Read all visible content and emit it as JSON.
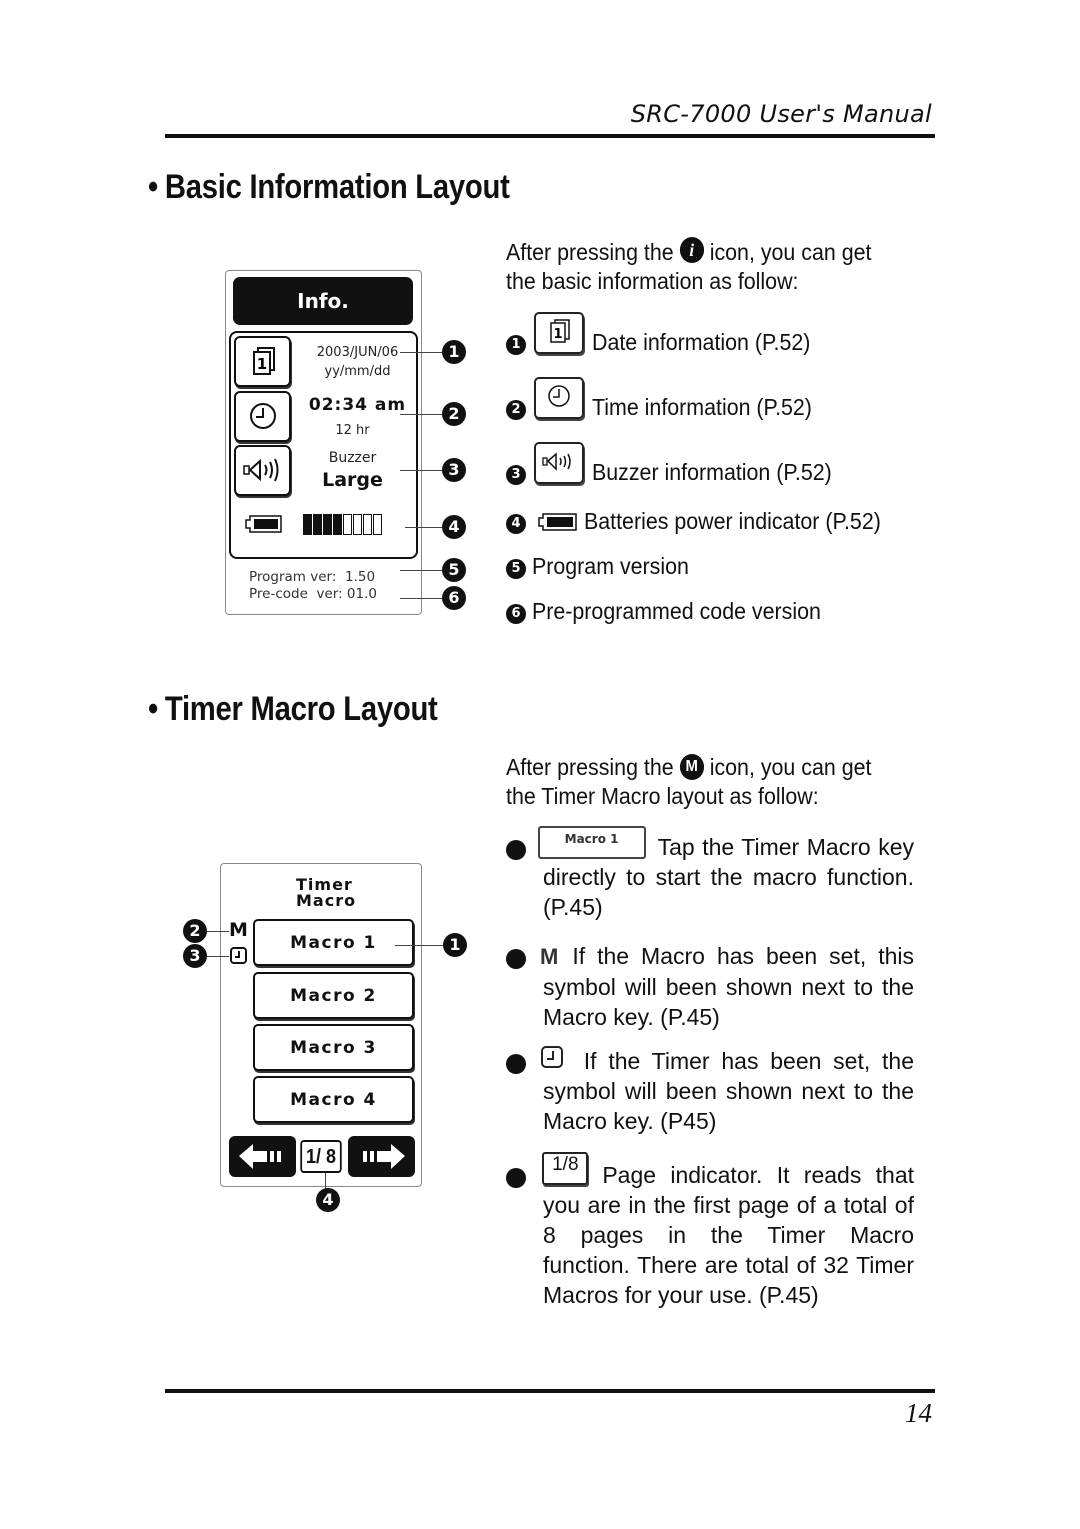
{
  "header": {
    "running_title": "SRC-7000 User's Manual"
  },
  "footer": {
    "page_number": "14"
  },
  "section_info": {
    "bullet": "•",
    "title": "Basic Information Layout",
    "intro_before": "After pressing the",
    "intro_icon": "info-icon",
    "intro_icon_glyph": "i",
    "intro_after": "icon, you can get the basic information as follow:",
    "device": {
      "title": "Info.",
      "date_value": "2003/JUN/06",
      "date_format": "yy/mm/dd",
      "time_value": "02:34 am",
      "time_format": "12 hr",
      "buzzer_label": "Buzzer",
      "buzzer_value": "Large",
      "battery_level": 0.5,
      "battery_segments_total": 8,
      "battery_segments_filled": 4,
      "program_ver": "Program ver:  1.50",
      "precode_ver": "Pre-code  ver: 01.0",
      "callouts": [
        "1",
        "2",
        "3",
        "4",
        "5",
        "6"
      ]
    },
    "items": [
      {
        "num": "1",
        "icon": "calendar-icon",
        "text": "Date information (P.52)"
      },
      {
        "num": "2",
        "icon": "clock-icon",
        "text": "Time information (P.52)"
      },
      {
        "num": "3",
        "icon": "speaker-icon",
        "text": "Buzzer information (P.52)"
      },
      {
        "num": "4",
        "icon": "battery-icon",
        "text": "Batteries power indicator (P.52)"
      },
      {
        "num": "5",
        "text": "Program version"
      },
      {
        "num": "6",
        "text": "Pre-programmed code version"
      }
    ]
  },
  "section_macro": {
    "bullet": "•",
    "title": "Timer Macro Layout",
    "intro_before": "After pressing the",
    "intro_icon": "macro-icon",
    "intro_icon_glyph": "M",
    "intro_after": "icon, you can get the Timer Macro layout as follow:",
    "device": {
      "title_line1": "Timer",
      "title_line2": "Macro",
      "macro_symbol": "M",
      "keys": [
        "Macro 1",
        "Macro 2",
        "Macro 3",
        "Macro 4"
      ],
      "page_indicator": "1/ 8",
      "current_page": 1,
      "total_pages": 8,
      "callouts": [
        "1",
        "2",
        "3",
        "4"
      ]
    },
    "items": [
      {
        "num": "1",
        "icon_label": "Macro 1",
        "text": "Tap the Timer Macro key directly to start the macro function. (P.45)"
      },
      {
        "num": "2",
        "icon_label": "M",
        "text": "If the Macro has been set, this symbol will been shown next to the Macro key. (P.45)"
      },
      {
        "num": "3",
        "icon": "timer-set-icon",
        "text": "If the Timer has been set, the symbol will been shown next to the Macro key. (P45)"
      },
      {
        "num": "4",
        "icon_label": "1/8",
        "text": "Page indicator. It reads that you are in the first page of a total of 8 pages in the Timer Macro function. There are total of 32 Timer Macros for your use. (P.45)"
      }
    ]
  }
}
